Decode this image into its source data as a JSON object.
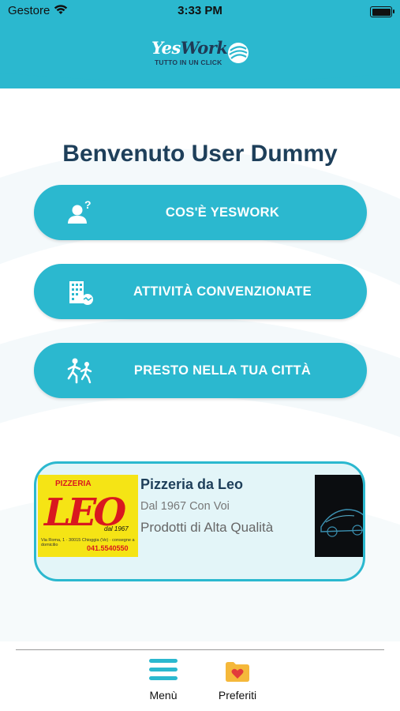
{
  "status_bar": {
    "carrier": "Gestore",
    "time": "3:33 PM"
  },
  "header": {
    "logo_yes": "Yes",
    "logo_work": "Work",
    "logo_tagline": "TUTTO IN UN CLICK"
  },
  "welcome": "Benvenuto User Dummy",
  "menu": [
    {
      "label": "COS'È YESWORK",
      "icon": "person-question-icon"
    },
    {
      "label": "ATTIVITÀ CONVENZIONATE",
      "icon": "building-handshake-icon"
    },
    {
      "label": "PRESTO NELLA TUA CITTÀ",
      "icon": "people-walking-icon"
    }
  ],
  "featured_card": {
    "title": "Pizzeria da Leo",
    "subtitle": "Dal 1967 Con Voi",
    "description": "Prodotti di Alta Qualità",
    "thumb": {
      "heading": "PIZZERIA",
      "name": "LEO",
      "since": "dal 1967",
      "address": "Via Roma, 1 · 30015 Chioggia (Ve) · consegne a domicilio",
      "phone": "041.5540550"
    }
  },
  "tab_bar": {
    "items": [
      {
        "label": "Menù",
        "icon": "hamburger-menu-icon"
      },
      {
        "label": "Preferiti",
        "icon": "heart-folder-icon"
      }
    ]
  },
  "colors": {
    "accent": "#2bb8cf",
    "title_text": "#1e3f5a",
    "card_bg": "#e3f5f8"
  }
}
